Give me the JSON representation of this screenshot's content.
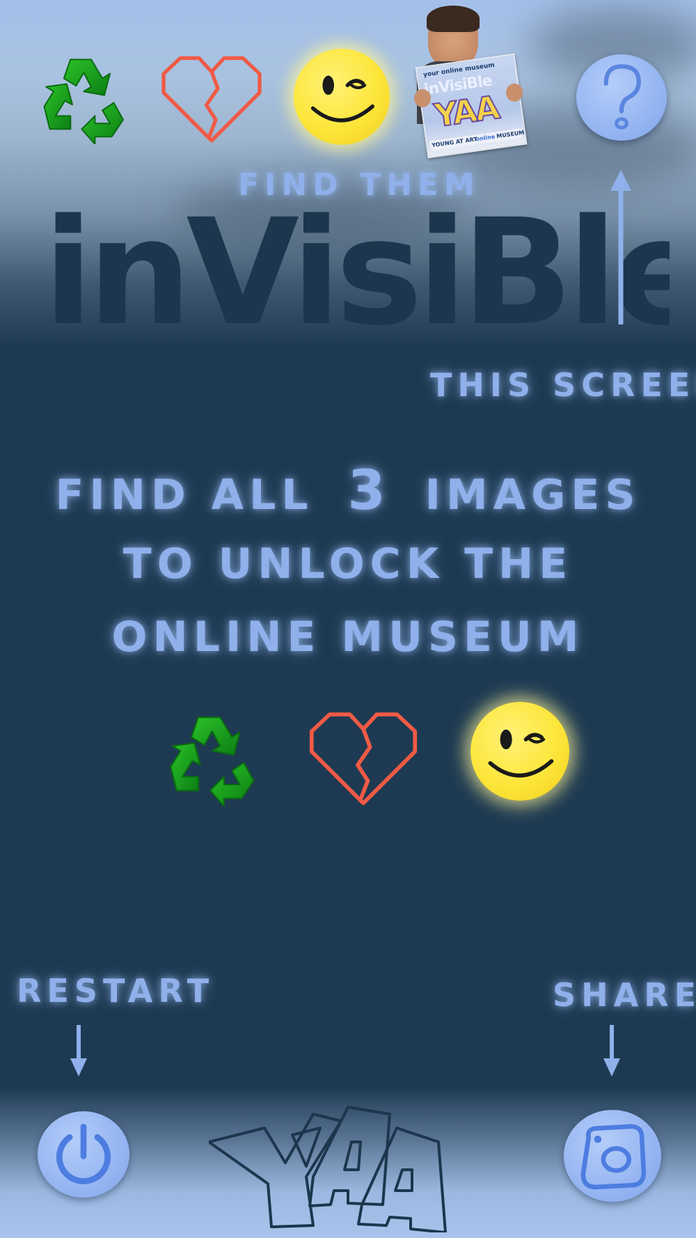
{
  "header": {
    "found_icons": [
      "recycle-icon",
      "broken-heart-icon",
      "wink-smiley-icon"
    ],
    "museum_photo": {
      "top_caption": "your online museum",
      "logo_word": "inVisiBle",
      "brand": "YAA",
      "footer_left": "YOUNG AT ART",
      "footer_mid": "online",
      "footer_right": "MUSEUM"
    },
    "help_button_icon": "question-mark-icon"
  },
  "labels": {
    "find_them": "FIND THEM",
    "this_screen": "THIS SCREEN",
    "restart": "RESTART",
    "share": "SHARE"
  },
  "title": "inVisiBle",
  "instructions": {
    "line1_before": "FIND ALL",
    "line1_number": "3",
    "line1_after": "IMAGES",
    "line2": "TO UNLOCK THE",
    "line3": "ONLINE MUSEUM"
  },
  "targets": [
    "recycle-icon",
    "broken-heart-icon",
    "wink-smiley-icon"
  ],
  "footer": {
    "restart_icon": "power-icon",
    "share_icon": "camera-icon",
    "logo": "YAA"
  },
  "colors": {
    "background": "#1e3a52",
    "text_glow": "#8fb0ea",
    "button": "#95b5f2",
    "heart": "#f05a45",
    "recycle": "#1aa01c",
    "smiley": "#fde63a"
  }
}
